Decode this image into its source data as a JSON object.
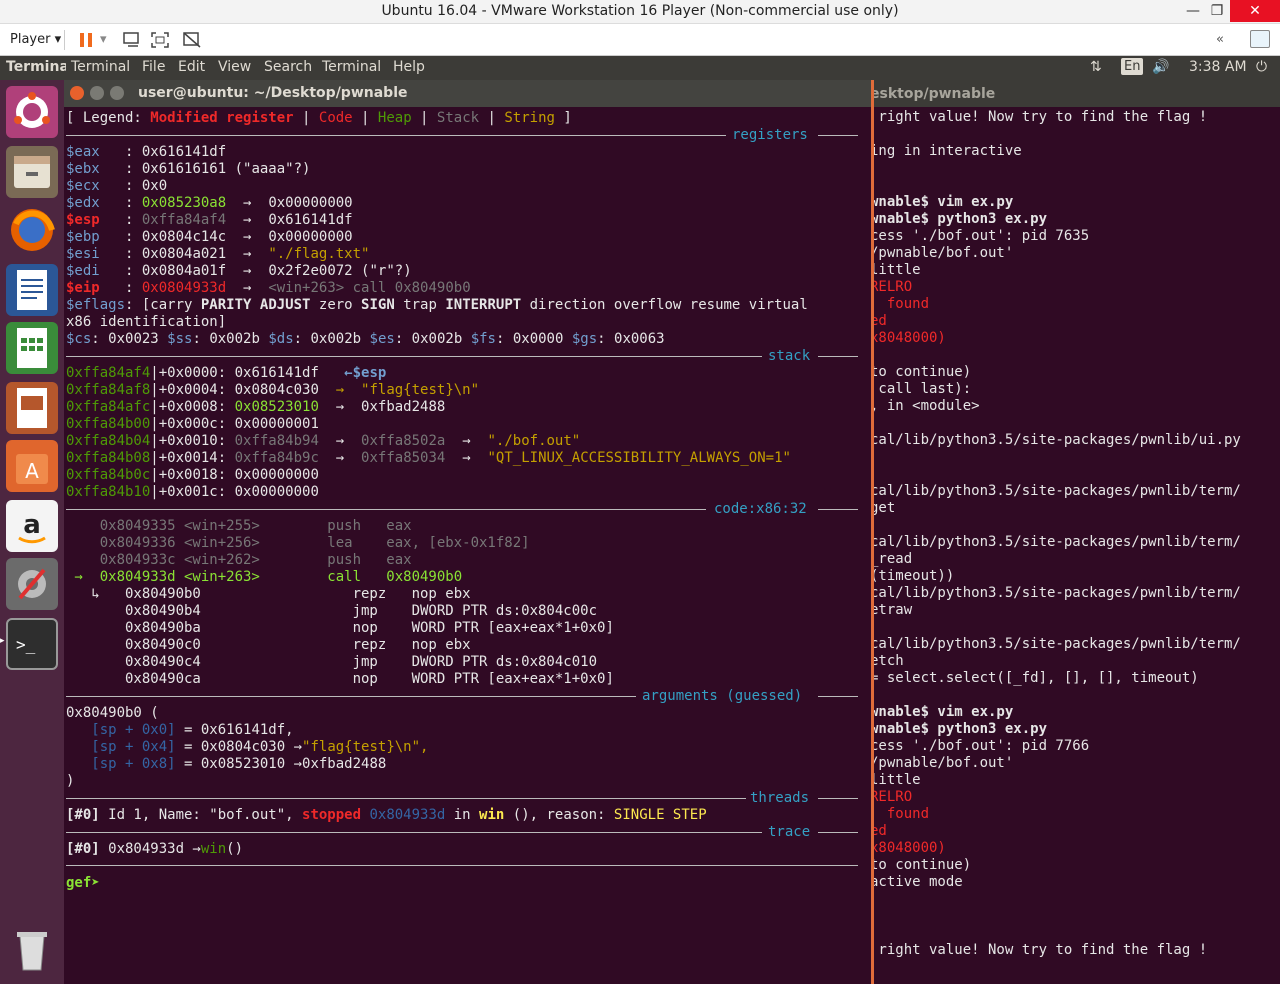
{
  "vm": {
    "title": "Ubuntu 16.04 - VMware Workstation 16 Player (Non-commercial use only)",
    "player": "Player",
    "minimize": "—",
    "restore": "❐",
    "close": "✕"
  },
  "panel": {
    "app": "Terminal",
    "menus": [
      "Terminal",
      "File",
      "Edit",
      "View",
      "Search",
      "Terminal",
      "Help"
    ],
    "lang": "En",
    "time": "3:38 AM"
  },
  "launcher": {
    "icons": [
      "ubuntu-dash-icon",
      "files-icon",
      "firefox-icon",
      "writer-icon",
      "calc-icon",
      "impress-icon",
      "software-center-icon",
      "amazon-icon",
      "settings-icon",
      "terminal-icon",
      "trash-icon"
    ]
  },
  "bg_terminal": {
    "title": "esktop/pwnable",
    "lines": [
      " right value! Now try to find the flag !",
      "",
      "ing in interactive",
      "",
      "",
      "wnable$ vim ex.py",
      "wnable$ python3 ex.py",
      "cess './bof.out': pid 7635",
      "/pwnable/bof.out'",
      "little",
      "RELRO",
      "  found",
      "ed",
      "x8048000)",
      "",
      "to continue)",
      " call last):",
      ", in <module>",
      "",
      "cal/lib/python3.5/site-packages/pwnlib/ui.py",
      "",
      "",
      "cal/lib/python3.5/site-packages/pwnlib/term/",
      "get",
      "",
      "cal/lib/python3.5/site-packages/pwnlib/term/",
      "_read",
      "(timeout))",
      "cal/lib/python3.5/site-packages/pwnlib/term/",
      "etraw",
      "",
      "cal/lib/python3.5/site-packages/pwnlib/term/",
      "etch",
      "= select.select([_fd], [], [], timeout)",
      "",
      "wnable$ vim ex.py",
      "wnable$ python3 ex.py",
      "cess './bof.out': pid 7766",
      "/pwnable/bof.out'",
      "little",
      "RELRO",
      "  found",
      "ed",
      "x8048000)",
      "to continue)",
      "active mode",
      "",
      "",
      "",
      " right value! Now try to find the flag !"
    ]
  },
  "fg_terminal": {
    "title": "user@ubuntu: ~/Desktop/pwnable",
    "legend": {
      "open": "[ Legend: ",
      "modified": "Modified register",
      "sep": " | ",
      "code": "Code",
      "heap": "Heap",
      "stack": "Stack",
      "string": "String",
      "close": " ]"
    },
    "sections": {
      "registers": "registers",
      "stack": "stack",
      "code": "code:x86:32",
      "arguments": "arguments (guessed)",
      "threads": "threads",
      "trace": "trace"
    },
    "registers": [
      {
        "name": "$eax",
        "sep": "   : ",
        "value": "0x616141df",
        "arrow": "",
        "deref": "",
        "modified": false
      },
      {
        "name": "$ebx",
        "sep": "   : ",
        "value": "0x61616161 (\"aaaa\"?)",
        "arrow": "",
        "deref": "",
        "modified": false
      },
      {
        "name": "$ecx",
        "sep": "   : ",
        "value": "0x0",
        "arrow": "",
        "deref": "",
        "modified": false
      },
      {
        "name": "$edx",
        "sep": "   : ",
        "value": "0x085230a8",
        "arrow": "  →  ",
        "deref": "0x00000000",
        "modified": false,
        "vcolor": "grn"
      },
      {
        "name": "$esp",
        "sep": "   : ",
        "value": "0xffa84af4",
        "arrow": "  →  ",
        "deref": "0x616141df",
        "modified": true,
        "vcolor": "grey"
      },
      {
        "name": "$ebp",
        "sep": "   : ",
        "value": "0x0804c14c",
        "arrow": "  →  ",
        "deref": "0x00000000",
        "modified": false
      },
      {
        "name": "$esi",
        "sep": "   : ",
        "value": "0x0804a021",
        "arrow": "  →  ",
        "deref": "\"./flag.txt\"",
        "modified": false,
        "dcolor": "yel"
      },
      {
        "name": "$edi",
        "sep": "   : ",
        "value": "0x0804a01f",
        "arrow": "  →  ",
        "deref": "0x2f2e0072 (\"r\"?)",
        "modified": false
      },
      {
        "name": "$eip",
        "sep": "   : ",
        "value": "0x0804933d",
        "arrow": "  →  ",
        "deref": "<win+263> call 0x80490b0",
        "modified": true,
        "vcolor": "redn",
        "dcolor": "grey"
      }
    ],
    "eflags": {
      "name": "$eflags",
      "text1": ": [carry ",
      "parity": "PARITY",
      "sp1": " ",
      "adjust": "ADJUST",
      "text2": " zero ",
      "sign": "SIGN",
      "text3": " trap ",
      "interrupt": "INTERRUPT",
      "text4": " direction overflow resume virtual",
      "line2": "x86 identification]"
    },
    "segments": [
      {
        "name": "$cs",
        "value": "0x0023"
      },
      {
        "name": "$ss",
        "value": "0x002b"
      },
      {
        "name": "$ds",
        "value": "0x002b"
      },
      {
        "name": "$es",
        "value": "0x002b"
      },
      {
        "name": "$fs",
        "value": "0x0000"
      },
      {
        "name": "$gs",
        "value": "0x0063"
      }
    ],
    "stack": [
      {
        "addr": "0xffa84af4",
        "off": "+0x0000: ",
        "val": "0x616141df",
        "rest": "   ←$esp",
        "vcolor": "white",
        "rcolor": "bl"
      },
      {
        "addr": "0xffa84af8",
        "off": "+0x0004: ",
        "val": "0x0804c030",
        "rest": "  →  \"flag{test}\\n\"",
        "vcolor": "white",
        "rcolor": "yel"
      },
      {
        "addr": "0xffa84afc",
        "off": "+0x0008: ",
        "val": "0x08523010",
        "rest": "  →  0xfbad2488",
        "vcolor": "grn",
        "rcolor": "white"
      },
      {
        "addr": "0xffa84b00",
        "off": "+0x000c: ",
        "val": "0x00000001",
        "rest": "",
        "vcolor": "white",
        "rcolor": "white"
      },
      {
        "addr": "0xffa84b04",
        "off": "+0x0010: ",
        "val": "0xffa84b94",
        "rest": "  →  0xffa8502a  →  \"./bof.out\"",
        "vcolor": "grey",
        "rcolor": "mix1"
      },
      {
        "addr": "0xffa84b08",
        "off": "+0x0014: ",
        "val": "0xffa84b9c",
        "rest": "  →  0xffa85034  →  \"QT_LINUX_ACCESSIBILITY_ALWAYS_ON=1\"",
        "vcolor": "grey",
        "rcolor": "mix2"
      },
      {
        "addr": "0xffa84b0c",
        "off": "+0x0018: ",
        "val": "0x00000000",
        "rest": "",
        "vcolor": "white",
        "rcolor": "white"
      },
      {
        "addr": "0xffa84b10",
        "off": "+0x001c: ",
        "val": "0x00000000",
        "rest": "",
        "vcolor": "white",
        "rcolor": "white"
      }
    ],
    "code": [
      {
        "text": "    0x8049335 <win+255>        push   eax",
        "cls": "grey"
      },
      {
        "text": "    0x8049336 <win+256>        lea    eax, [ebx-0x1f82]",
        "cls": "grey"
      },
      {
        "text": "    0x804933c <win+262>        push   eax",
        "cls": "grey"
      },
      {
        "text": " →  0x804933d <win+263>        call   0x80490b0",
        "cls": "grn"
      },
      {
        "text": "   ↳   0x80490b0                  repz   nop ebx",
        "cls": "white"
      },
      {
        "text": "       0x80490b4                  jmp    DWORD PTR ds:0x804c00c",
        "cls": "white"
      },
      {
        "text": "       0x80490ba                  nop    WORD PTR [eax+eax*1+0x0]",
        "cls": "white"
      },
      {
        "text": "       0x80490c0                  repz   nop ebx",
        "cls": "white"
      },
      {
        "text": "       0x80490c4                  jmp    DWORD PTR ds:0x804c010",
        "cls": "white"
      },
      {
        "text": "       0x80490ca                  nop    WORD PTR [eax+eax*1+0x0]",
        "cls": "white"
      }
    ],
    "arguments": {
      "head": "0x80490b0 (",
      "args": [
        {
          "sp": "[sp + 0x0]",
          "val": " = 0x616141df,",
          "extra": ""
        },
        {
          "sp": "[sp + 0x4]",
          "val": " = 0x0804c030 →",
          "extra": "\"flag{test}\\n\","
        },
        {
          "sp": "[sp + 0x8]",
          "val": " = 0x08523010 →0xfbad2488",
          "extra": ""
        }
      ],
      "close": ")"
    },
    "thread": {
      "id": "[#0]",
      "t1": " Id 1, Name: \"bof.out\", ",
      "stopped": "stopped",
      "addr": " 0x804933d",
      "t2": " in ",
      "win": "win",
      "t3": " (), reason: ",
      "reason": "SINGLE STEP"
    },
    "trace": {
      "id": "[#0]",
      "t1": " 0x804933d →",
      "fn": "win",
      "t2": "()"
    },
    "prompt": "gef➤"
  }
}
